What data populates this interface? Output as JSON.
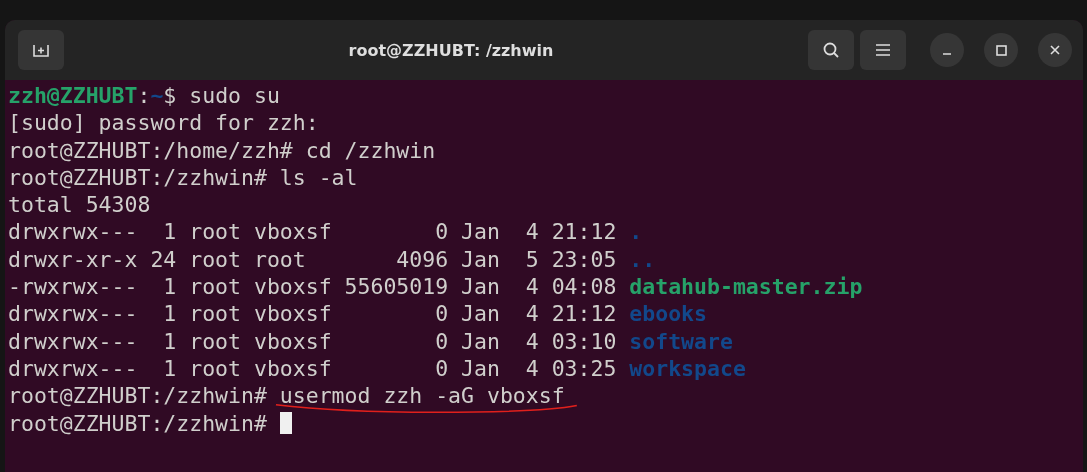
{
  "window": {
    "title": "root@ZZHUBT: /zzhwin"
  },
  "terminal": {
    "lines": [
      {
        "segments": [
          {
            "text": "zzh@ZZHUBT",
            "kind": "user"
          },
          {
            "text": ":",
            "kind": "plain"
          },
          {
            "text": "~",
            "kind": "path"
          },
          {
            "text": "$ sudo su",
            "kind": "plain"
          }
        ]
      },
      {
        "segments": [
          {
            "text": "[sudo] password for zzh:",
            "kind": "plain"
          }
        ]
      },
      {
        "segments": [
          {
            "text": "root@ZZHUBT:/home/zzh# cd /zzhwin",
            "kind": "plain"
          }
        ]
      },
      {
        "segments": [
          {
            "text": "root@ZZHUBT:/zzhwin# ls -al",
            "kind": "plain"
          }
        ]
      },
      {
        "segments": [
          {
            "text": "total 54308",
            "kind": "plain"
          }
        ]
      },
      {
        "segments": [
          {
            "text": "drwxrwx---  1 root vboxsf        0 Jan  4 21:12 ",
            "kind": "plain"
          },
          {
            "text": ".",
            "kind": "dir"
          }
        ]
      },
      {
        "segments": [
          {
            "text": "drwxr-xr-x 24 root root       4096 Jan  5 23:05 ",
            "kind": "plain"
          },
          {
            "text": "..",
            "kind": "dir"
          }
        ]
      },
      {
        "segments": [
          {
            "text": "-rwxrwx---  1 root vboxsf 55605019 Jan  4 04:08 ",
            "kind": "plain"
          },
          {
            "text": "datahub-master.zip",
            "kind": "archive"
          }
        ]
      },
      {
        "segments": [
          {
            "text": "drwxrwx---  1 root vboxsf        0 Jan  4 21:12 ",
            "kind": "plain"
          },
          {
            "text": "ebooks",
            "kind": "dir"
          }
        ]
      },
      {
        "segments": [
          {
            "text": "drwxrwx---  1 root vboxsf        0 Jan  4 03:10 ",
            "kind": "plain"
          },
          {
            "text": "software",
            "kind": "dir"
          }
        ]
      },
      {
        "segments": [
          {
            "text": "drwxrwx---  1 root vboxsf        0 Jan  4 03:25 ",
            "kind": "plain"
          },
          {
            "text": "workspace",
            "kind": "dir"
          }
        ]
      },
      {
        "segments": [
          {
            "text": "root@ZZHUBT:/zzhwin# ",
            "kind": "plain"
          },
          {
            "text": "usermod zzh -aG vboxsf",
            "kind": "plain",
            "underlined": true
          }
        ]
      },
      {
        "segments": [
          {
            "text": "root@ZZHUBT:/zzhwin# ",
            "kind": "plain"
          }
        ],
        "cursor": true
      }
    ]
  }
}
